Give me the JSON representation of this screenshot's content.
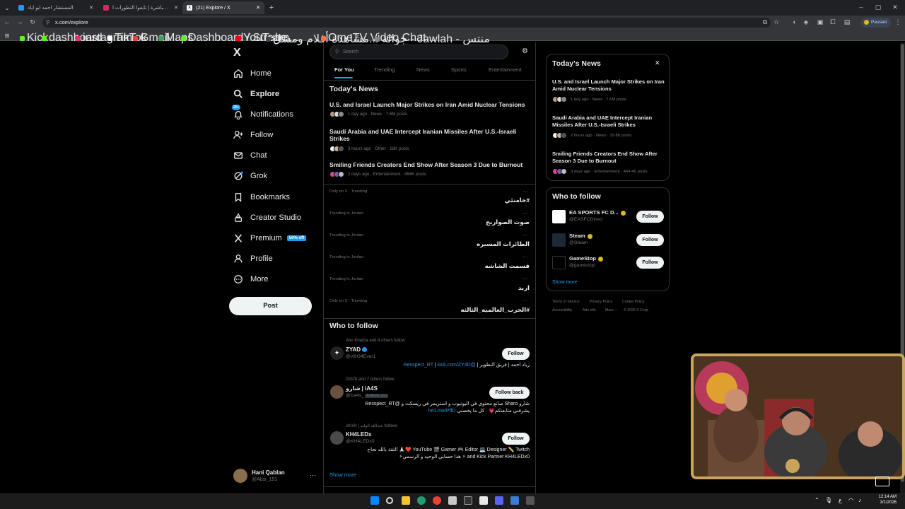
{
  "browser": {
    "tabs": [
      {
        "title": "المستشار احمد ابو اياد",
        "color": "#1d9bf0"
      },
      {
        "title": "تغطية مباشرة | تابعوا التطورات ا..",
        "color": "#e0245e"
      },
      {
        "title": "(21) Explore / X",
        "color": "#ffffff"
      }
    ],
    "url": "x.com/explore",
    "profile_status": "Paused",
    "bookmarks": [
      {
        "label": "Kick",
        "color": "#53fc18"
      },
      {
        "label": "dashboard",
        "color": "#53fc18"
      },
      {
        "label": "instagram",
        "color": "#e1306c"
      },
      {
        "label": "TikTok",
        "color": "#ffffff"
      },
      {
        "label": "Gmail",
        "color": "#ea4335"
      },
      {
        "label": "Maps",
        "color": "#34a853"
      },
      {
        "label": "Dashboard / Stream...",
        "color": "#53fc18"
      },
      {
        "label": "YouTube",
        "color": "#ff0000"
      },
      {
        "label": "مشاهدة أفلام ومسل...",
        "color": "#444444"
      },
      {
        "label": "OmeTV Video Chat...",
        "color": "#ff7043"
      },
      {
        "label": "جوالة - Jawlah - منتس",
        "color": "#888888"
      }
    ]
  },
  "nav": {
    "logo": "X",
    "items": [
      {
        "label": "Home",
        "icon": "home-icon"
      },
      {
        "label": "Explore",
        "icon": "search-icon"
      },
      {
        "label": "Notifications",
        "icon": "bell-icon",
        "badge": "20+"
      },
      {
        "label": "Follow",
        "icon": "follow-icon"
      },
      {
        "label": "Chat",
        "icon": "mail-icon"
      },
      {
        "label": "Grok",
        "icon": "grok-icon"
      },
      {
        "label": "Bookmarks",
        "icon": "bookmark-icon"
      },
      {
        "label": "Creator Studio",
        "icon": "creator-studio-icon"
      },
      {
        "label": "Premium",
        "icon": "x-icon",
        "badge": "50% off"
      },
      {
        "label": "Profile",
        "icon": "profile-icon"
      },
      {
        "label": "More",
        "icon": "more-icon"
      }
    ],
    "post_button": "Post",
    "account": {
      "name": "Hani Qablan",
      "handle": "@Absi_151"
    }
  },
  "main": {
    "search_placeholder": "Search",
    "tabs": [
      "For You",
      "Trending",
      "News",
      "Sports",
      "Entertainment"
    ],
    "todays_news_heading": "Today's News",
    "news": [
      {
        "title": "U.S. and Israel Launch Major Strikes on Iran Amid Nuclear Tensions",
        "meta": "1 day ago · News · 7.6M posts"
      },
      {
        "title": "Saudi Arabia and UAE Intercept Iranian Missiles After U.S.-Israeli Strikes",
        "meta": "3 hours ago · Other · 18K posts"
      },
      {
        "title": "Smiling Friends Creators End Show After Season 3 Due to Burnout",
        "meta": "2 days ago · Entertainment · 464K posts"
      }
    ],
    "trends": [
      {
        "context": "Only on X · Trending",
        "tag": "#خامنئي"
      },
      {
        "context": "Trending in Jordan",
        "tag": "صوت الصواريخ"
      },
      {
        "context": "Trending in Jordan",
        "tag": "الطائرات المسيره"
      },
      {
        "context": "Trending in Jordan",
        "tag": "قسمت الشاشه"
      },
      {
        "context": "Trending in Jordan",
        "tag": "اربد"
      },
      {
        "context": "Only on X · Trending",
        "tag": "#الحرب_العالميه_الثالثه"
      }
    ],
    "who_to_follow_heading": "Who to follow",
    "who_to_follow": [
      {
        "followed_by": "Abo Kharba and 4 others follow",
        "name": "ZYAD",
        "handle": "@vl9G4Ever1",
        "button": "Follow",
        "bio_link": "kick.com/ZY4D",
        "bio_link2": "@Resspect_RT",
        "bio_text": "زياد احمد | فريق التطوير"
      },
      {
        "followed_by": "Drb7h and 7 others follow",
        "name": "شارو | iA4S",
        "handle": "@1a4s_",
        "follows_you": "Follows you",
        "button": "Follow back",
        "bio_line1": "شارو Sharo صانع محتوى في اليوتيوب و استريمر في ريسكت و @Resspect_RT",
        "bio_line2": "يشرفني متابعتكم💗 . كل ما يخصني",
        "bio_link": "he1.me/PffD"
      },
      {
        "followed_by": "xKn9r | عبدالله الوليد follows",
        "name": "KH4LEDx",
        "handle": "@KH4LEDx0",
        "button": "Follow",
        "bio_line1": "YouTube 🎬 Gamer 🎮 Editor 💻 Designer ✏️ Twitch ❤️🙏🏻 الثقة بالله نجاح",
        "bio_line2": "and Kick Partner KH4LEDx0 ⚡ هذا حسابي الوحيد و الرسمي⚡"
      }
    ],
    "show_more": "Show more"
  },
  "sidebar": {
    "todays_news_heading": "Today's News",
    "news": [
      {
        "title": "U.S. and Israel Launch Major Strikes on Iran Amid Nuclear Tensions",
        "meta": "1 day ago · News · 7.6M posts"
      },
      {
        "title": "Saudi Arabia and UAE Intercept Iranian Missiles After U.S.-Israeli Strikes",
        "meta": "2 hours ago · News · 19.8K posts"
      },
      {
        "title": "Smiling Friends Creators End Show After Season 3 Due to Burnout",
        "meta": "3 days ago · Entertainment · 464.4K posts"
      }
    ],
    "who_to_follow_heading": "Who to follow",
    "who_to_follow": [
      {
        "name": "EA SPORTS FC D...",
        "handle": "@EASFCDirect",
        "button": "Follow"
      },
      {
        "name": "Steam",
        "handle": "@Steam",
        "button": "Follow"
      },
      {
        "name": "GameStop",
        "handle": "@gamestop",
        "button": "Follow"
      }
    ],
    "show_more": "Show more",
    "footer": [
      "Terms of Service",
      "Privacy Policy",
      "Cookie Policy",
      "Accessibility",
      "Ads info",
      "More ···",
      "© 2026 X Corp."
    ]
  },
  "taskbar": {
    "time": "12:14 AM",
    "date": "3/1/2026",
    "lang": "ع"
  },
  "colors": {
    "accent": "#1d9bf0",
    "premium_badge": "#1d9bf0",
    "webcam_frame": "#c9a45a"
  }
}
